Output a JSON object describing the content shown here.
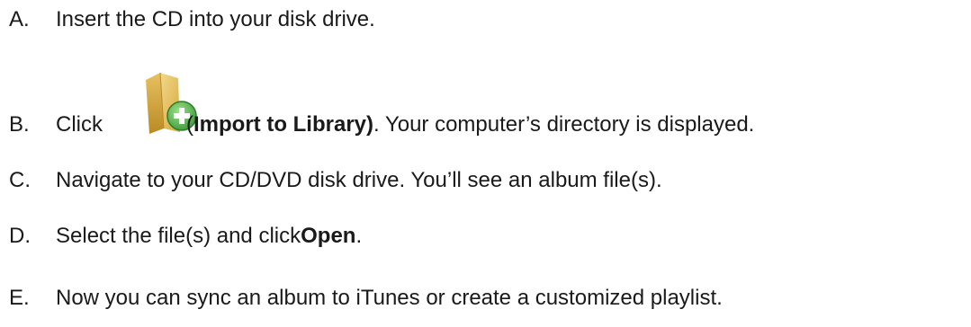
{
  "steps": [
    {
      "letter": "A.",
      "text": "Insert the CD into your disk drive."
    },
    {
      "letter": "B.",
      "text_before": "Click ",
      "paren_open": "(",
      "bold": "Import to Library)",
      "text_after": ". Your computer’s directory is displayed.",
      "icon": "folder-add-icon"
    },
    {
      "letter": "C.",
      "text": "Navigate to your CD/DVD disk drive. You’ll see an album file(s)."
    },
    {
      "letter": "D.",
      "text_before": "Select the file(s) and click ",
      "bold": "Open",
      "text_after": "."
    },
    {
      "letter": "E.",
      "text": "Now you can sync an album to iTunes or create a customized playlist."
    }
  ],
  "colors": {
    "folder": "#d9b24a",
    "folder_light": "#f0d27a",
    "plus_badge": "#5cb85c"
  }
}
